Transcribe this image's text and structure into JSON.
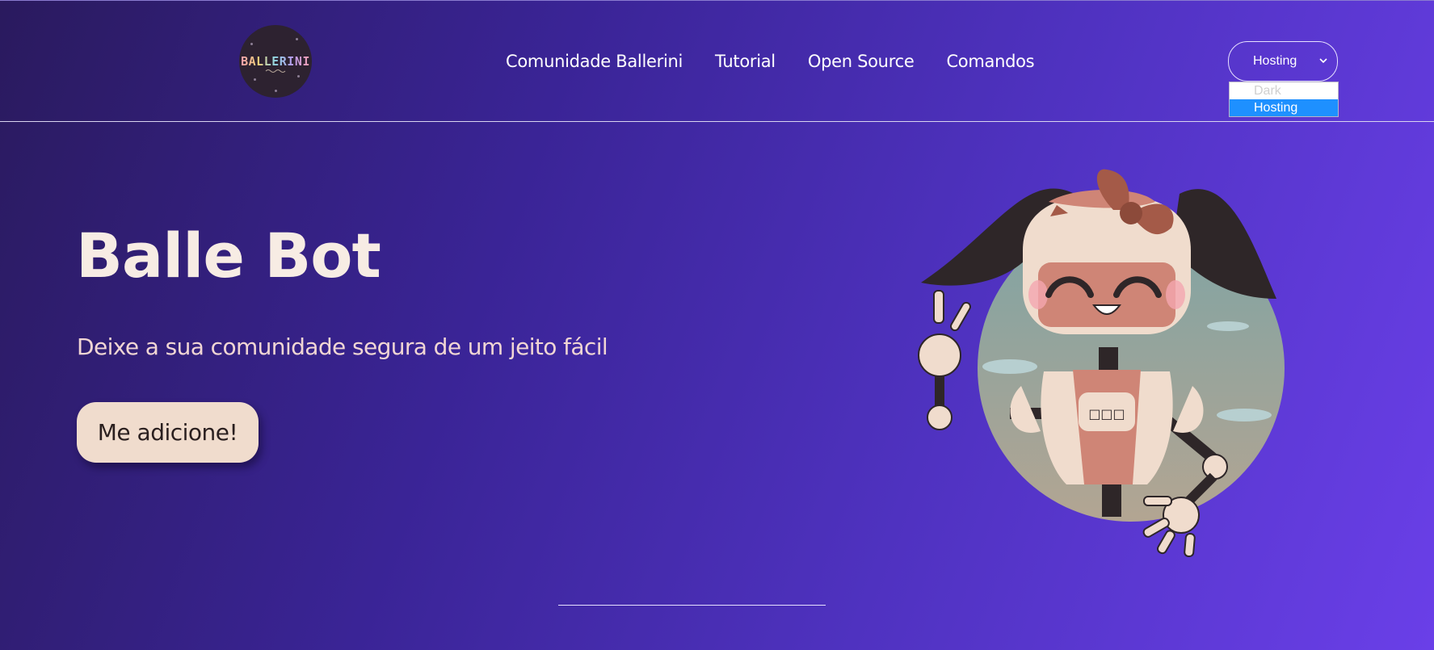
{
  "header": {
    "logo_text": "BALLERINI",
    "nav": [
      {
        "label": "Comunidade Ballerini"
      },
      {
        "label": "Tutorial"
      },
      {
        "label": "Open Source"
      },
      {
        "label": "Comandos"
      }
    ],
    "theme_select": {
      "selected": "Hosting",
      "options": [
        "Dark",
        "Hosting"
      ],
      "open": true
    }
  },
  "hero": {
    "title": "Balle Bot",
    "subtitle": "Deixe a sua comunidade segura de um jeito fácil",
    "cta_label": "Me adicione!",
    "chest_text": "□□□"
  },
  "colors": {
    "bg_start": "#2a1a5e",
    "bg_end": "#6a3fe8",
    "title": "#f7ece4",
    "subtitle": "#f1d6d4",
    "button_bg": "#f0dccd",
    "select_highlight": "#1e90ff"
  }
}
